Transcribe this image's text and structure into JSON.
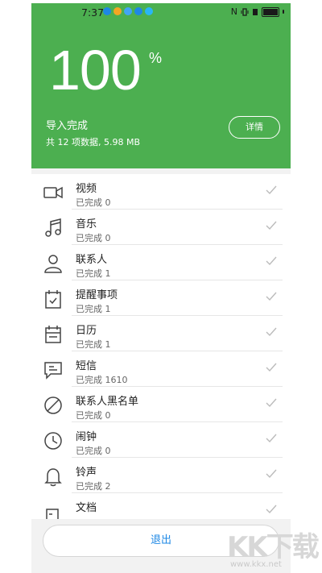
{
  "status_bar": {
    "time": "7:37",
    "right_text": "N"
  },
  "header": {
    "percent": "100",
    "percent_sign": "%",
    "status": "导入完成",
    "summary": "共 12 项数据, 5.98 MB",
    "details_label": "详情",
    "accent_color": "#4caf50"
  },
  "items": [
    {
      "title": "视频",
      "status": "已完成  0",
      "icon": "video-icon"
    },
    {
      "title": "音乐",
      "status": "已完成  0",
      "icon": "music-icon"
    },
    {
      "title": "联系人",
      "status": "已完成  1",
      "icon": "contact-icon"
    },
    {
      "title": "提醒事项",
      "status": "已完成  1",
      "icon": "reminder-icon"
    },
    {
      "title": "日历",
      "status": "已完成  1",
      "icon": "calendar-icon"
    },
    {
      "title": "短信",
      "status": "已完成  1610",
      "icon": "message-icon"
    },
    {
      "title": "联系人黑名单",
      "status": "已完成  0",
      "icon": "blocked-icon"
    },
    {
      "title": "闹钟",
      "status": "已完成  0",
      "icon": "clock-icon"
    },
    {
      "title": "铃声",
      "status": "已完成  2",
      "icon": "bell-icon"
    },
    {
      "title": "文档",
      "status": "",
      "icon": "document-icon"
    }
  ],
  "footer": {
    "exit_label": "退出",
    "link_color": "#1e88e5"
  },
  "watermark": {
    "logo": "KK下载",
    "site": "www.kkx.net"
  }
}
